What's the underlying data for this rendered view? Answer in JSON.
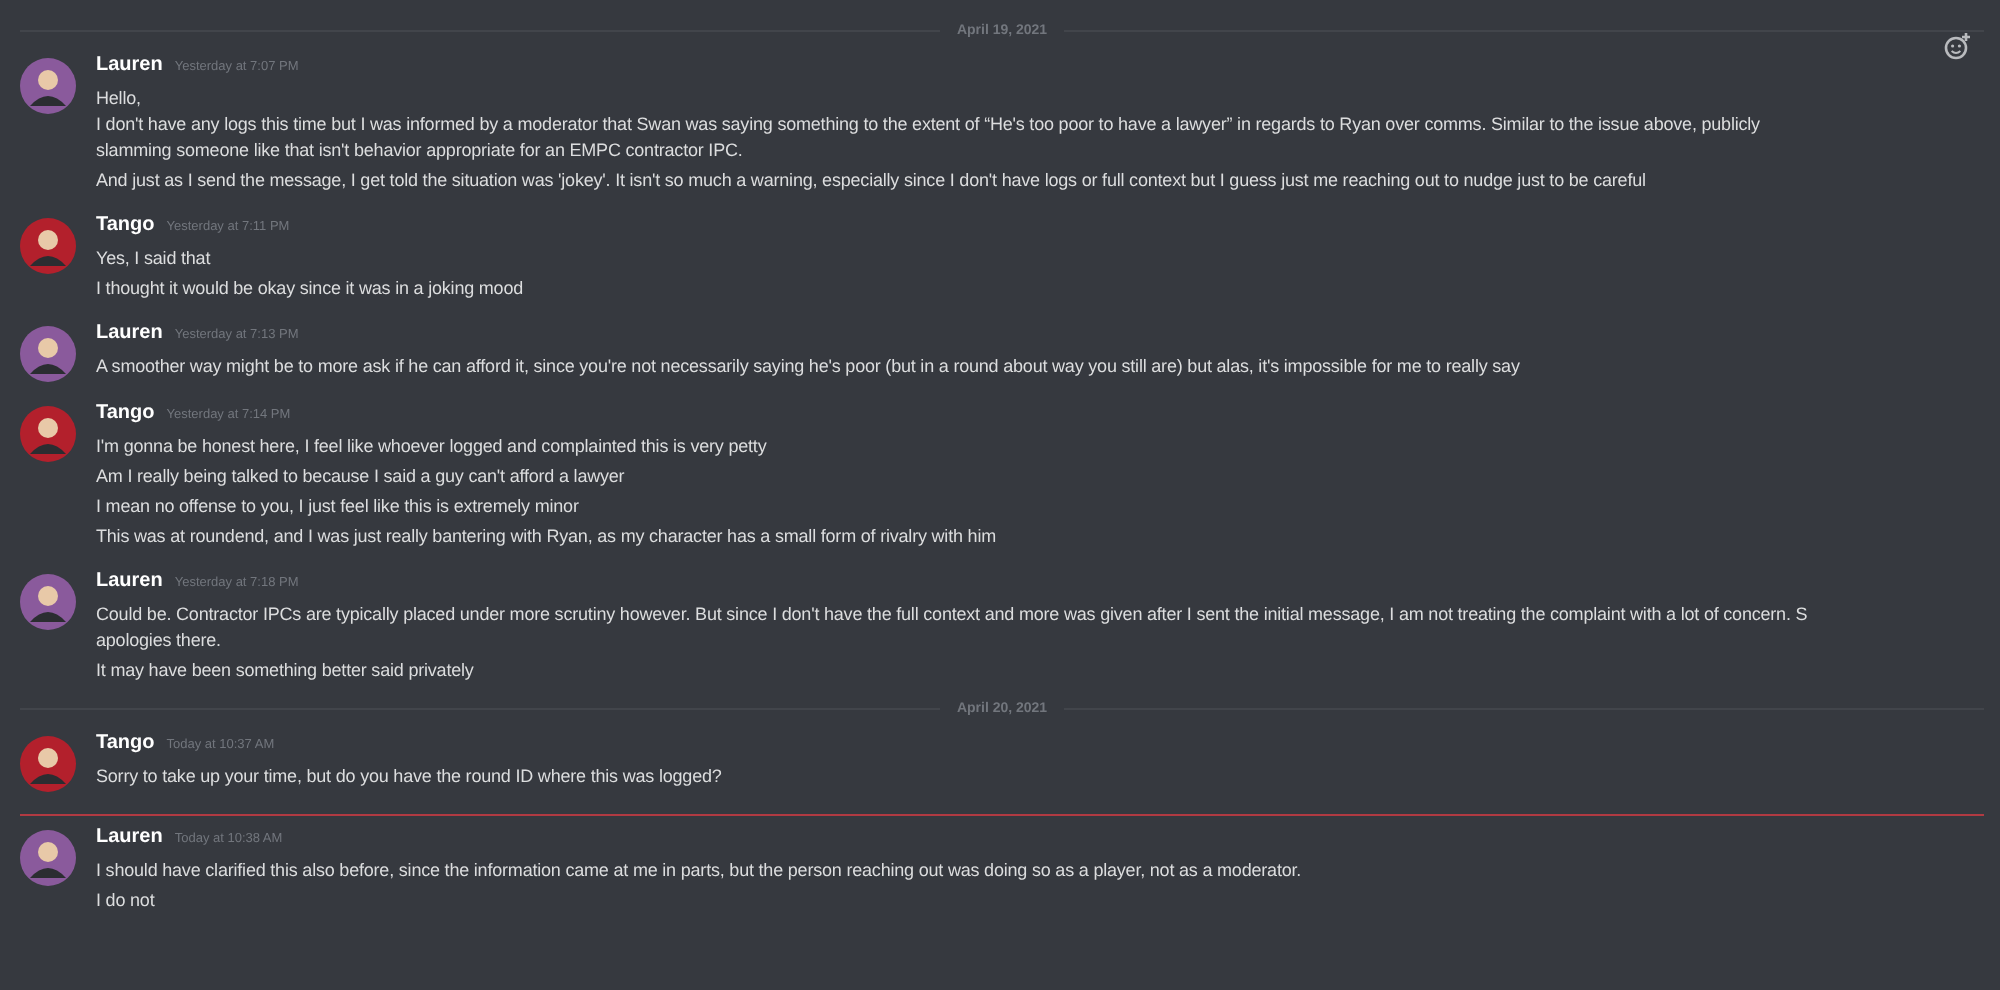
{
  "items": [
    {
      "kind": "divider",
      "label": "April 19, 2021"
    },
    {
      "kind": "group",
      "author": "Lauren",
      "color": "#8a5a9c",
      "time": "Yesterday at 7:07 PM",
      "messages": [
        {
          "lines": [
            "Hello,",
            "I don't have any logs this time but I was informed by a moderator that Swan was saying something to the extent of “He's too poor to have a lawyer” in regards to Ryan over comms. Similar to the issue above, publicly",
            "slamming someone like that isn't behavior appropriate for an EMPC contractor IPC."
          ]
        },
        {
          "lines": [
            "And just as I send the message, I get told the situation was 'jokey'. It isn't so much a warning, especially since I don't have logs or full context but I guess just me reaching out to nudge just to be careful"
          ]
        }
      ]
    },
    {
      "kind": "group",
      "author": "Tango",
      "color": "#b3202c",
      "time": "Yesterday at 7:11 PM",
      "messages": [
        {
          "lines": [
            "Yes, I said that"
          ]
        },
        {
          "lines": [
            "I thought it would be okay since it was in a joking mood"
          ]
        }
      ]
    },
    {
      "kind": "group",
      "author": "Lauren",
      "color": "#8a5a9c",
      "time": "Yesterday at 7:13 PM",
      "messages": [
        {
          "lines": [
            "A smoother way might be to more ask if he can afford it, since you're not necessarily saying he's poor (but in a round about way you still are) but alas, it's impossible for me to really say"
          ]
        }
      ]
    },
    {
      "kind": "group",
      "author": "Tango",
      "color": "#b3202c",
      "time": "Yesterday at 7:14 PM",
      "messages": [
        {
          "lines": [
            "I'm gonna be honest here, I feel like whoever logged and complainted this is very petty"
          ]
        },
        {
          "lines": [
            "Am I really being talked to because I said a guy can't afford a lawyer"
          ]
        },
        {
          "lines": [
            "I mean no offense to you, I just feel like this is extremely minor"
          ]
        },
        {
          "lines": [
            "This was at roundend, and I was just really bantering with Ryan, as my character has a small form of rivalry with him"
          ]
        }
      ]
    },
    {
      "kind": "group",
      "author": "Lauren",
      "color": "#8a5a9c",
      "time": "Yesterday at 7:18 PM",
      "messages": [
        {
          "lines": [
            "Could be. Contractor IPCs are typically placed under more scrutiny however. But since I don't have the full context and more was given after I sent the initial message, I am not treating the complaint with a lot of concern. S",
            "apologies there."
          ]
        },
        {
          "lines": [
            "It may have been something better said privately"
          ]
        }
      ]
    },
    {
      "kind": "divider",
      "label": "April 20, 2021"
    },
    {
      "kind": "group",
      "author": "Tango",
      "color": "#b3202c",
      "time": "Today at 10:37 AM",
      "messages": [
        {
          "lines": [
            "Sorry to take up your time, but do you have the round ID where this was logged?"
          ]
        }
      ]
    },
    {
      "kind": "new-divider"
    },
    {
      "kind": "group",
      "author": "Lauren",
      "color": "#8a5a9c",
      "time": "Today at 10:38 AM",
      "messages": [
        {
          "lines": [
            "I should have clarified this also before, since the information came at me in parts, but the person reaching out was doing so as a player, not as a moderator."
          ]
        },
        {
          "lines": [
            "I do not"
          ]
        }
      ]
    }
  ]
}
